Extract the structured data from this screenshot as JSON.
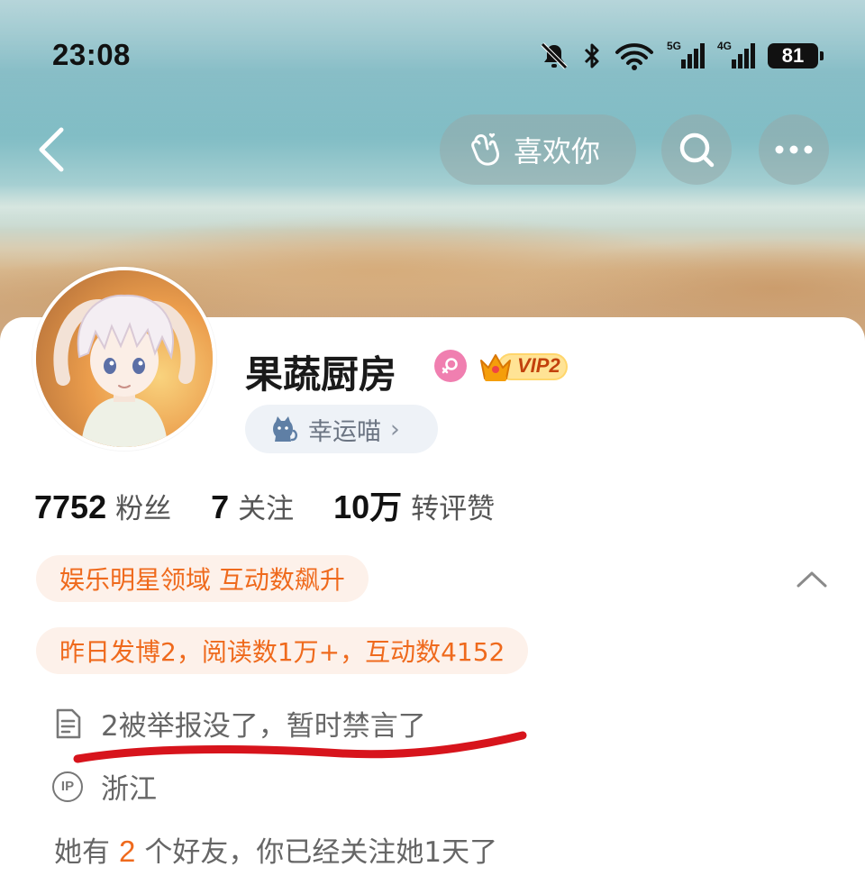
{
  "status_bar": {
    "time": "23:08",
    "signal_1_label": "5G",
    "signal_2_label": "4G",
    "battery": "81"
  },
  "nav": {
    "back_icon": "chevron-left-icon",
    "like_label": "喜欢你",
    "search_icon": "search-icon",
    "more_icon": "more-icon"
  },
  "profile": {
    "name": "果蔬厨房",
    "gender": "female",
    "vip_label": "VIP2",
    "lucky_pill_label": "幸运喵",
    "lucky_pill_chevron": "›"
  },
  "stats": [
    {
      "value": "7752",
      "label": "粉丝"
    },
    {
      "value": "7",
      "label": "关注"
    },
    {
      "value": "10万",
      "label": "转评赞"
    }
  ],
  "tags": {
    "domain": "娱乐明星领域 互动数飙升",
    "activity": "昨日发博2，阅读数1万+，互动数4152"
  },
  "info": {
    "bio": "2被举报没了，暂时禁言了",
    "ip_badge": "IP",
    "ip_location": "浙江"
  },
  "friends": {
    "prefix": "她有",
    "count": "2",
    "suffix": "个好友，你已经关注她1天了"
  },
  "colors": {
    "accent_orange": "#ef6a1d",
    "tag_bg": "#fdf1ea",
    "gender_pink": "#f07fb0",
    "annotation_red": "#d7141c"
  }
}
